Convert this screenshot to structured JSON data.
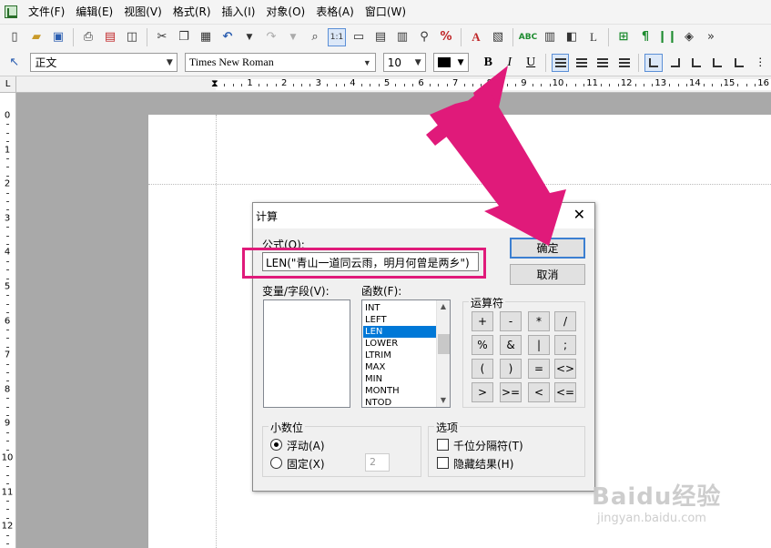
{
  "menu": [
    "文件(F)",
    "编辑(E)",
    "视图(V)",
    "格式(R)",
    "插入(I)",
    "对象(O)",
    "表格(A)",
    "窗口(W)"
  ],
  "format_toolbar": {
    "style": "正文",
    "font": "Times New Roman",
    "size": "10",
    "bold": "B",
    "italic": "I",
    "underline": "U"
  },
  "toolbar_more": "»",
  "ruler_corner": "L",
  "ruler_h_numbers": [
    "1",
    "2",
    "3",
    "4",
    "5",
    "6",
    "7",
    "8",
    "9",
    "10",
    "11",
    "12",
    "13",
    "14",
    "15",
    "16"
  ],
  "ruler_v_numbers": [
    "0",
    "1",
    "2",
    "3",
    "4",
    "5",
    "6",
    "7",
    "8",
    "9",
    "10",
    "11",
    "12"
  ],
  "dialog": {
    "title": "计算",
    "close": "✕",
    "formula_label": "公式(O):",
    "formula_value": "LEN(\"青山一道同云雨，明月何曾是两乡\")",
    "ok": "确定",
    "cancel": "取消",
    "variables_label": "变量/字段(V):",
    "functions_label": "函数(F):",
    "functions": [
      "INT",
      "LEFT",
      "LEN",
      "LOWER",
      "LTRIM",
      "MAX",
      "MIN",
      "MONTH",
      "NTOD"
    ],
    "selected_function": "LEN",
    "operators_label": "运算符",
    "operators": [
      "+",
      "-",
      "*",
      "/",
      "%",
      "&",
      "|",
      ";",
      "(",
      ")",
      "=",
      "<>",
      ">",
      ">=",
      "<",
      "<="
    ],
    "decimal_label": "小数位",
    "float_option": "浮动(A)",
    "fixed_option": "固定(X)",
    "fixed_value": "2",
    "options_label": "选项",
    "thousands_option": "千位分隔符(T)",
    "hide_result_option": "隐藏结果(H)"
  },
  "annotation_color": "#e01a7a",
  "watermark": {
    "logo": "Baidu经验",
    "url": "jingyan.baidu.com"
  }
}
